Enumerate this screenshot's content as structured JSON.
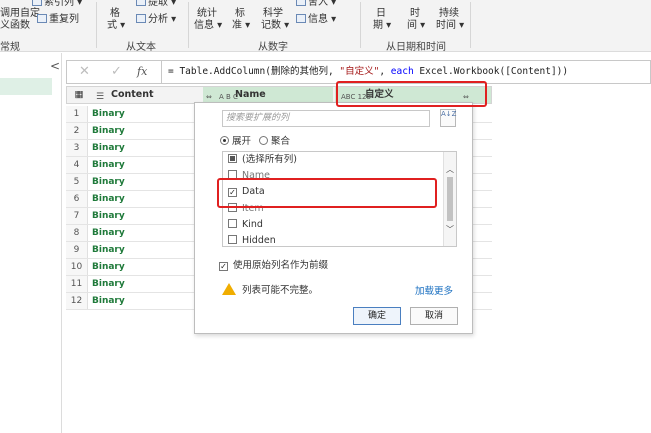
{
  "ribbon": {
    "top_row_fragments": [
      "索引列",
      "提取",
      "统计",
      "标",
      "科学",
      "舍入",
      "日",
      "时",
      "持续"
    ],
    "custom_func_line1": "调用自定",
    "custom_func_line2": "义函数",
    "duplicate_col": "重复列",
    "format_line1": "格",
    "format_line2": "式",
    "parse": "分析",
    "stats_info": "信息",
    "standard": "准",
    "sci_count": "记数",
    "info": "信息",
    "date_period": "期",
    "time_between": "间",
    "duration_time": "时间",
    "group_general": "常规",
    "group_from_text": "从文本",
    "group_from_number": "从数字",
    "group_from_datetime": "从日期和时间"
  },
  "formula_bar": {
    "cancel_glyph": "✕",
    "commit_glyph": "✓",
    "fx_label": "fx",
    "formula_parts": {
      "prefix": "= Table.AddColumn(删除的其他列, ",
      "string": "\"自定义\"",
      "mid": ", ",
      "keyword": "each",
      "suffix": " Excel.Workbook([Content]))"
    }
  },
  "table": {
    "columns": [
      {
        "label": "Content",
        "type_icon": "list-icon"
      },
      {
        "label": "Name",
        "type_icon": "abc-icon",
        "type_text": "A B C"
      },
      {
        "label": "自定义",
        "type_icon": "abc123-icon",
        "type_text": "ABC 123"
      }
    ],
    "rows": [
      {
        "index": "1",
        "content": "Binary"
      },
      {
        "index": "2",
        "content": "Binary"
      },
      {
        "index": "3",
        "content": "Binary"
      },
      {
        "index": "4",
        "content": "Binary"
      },
      {
        "index": "5",
        "content": "Binary"
      },
      {
        "index": "6",
        "content": "Binary"
      },
      {
        "index": "7",
        "content": "Binary"
      },
      {
        "index": "8",
        "content": "Binary"
      },
      {
        "index": "9",
        "content": "Binary"
      },
      {
        "index": "10",
        "content": "Binary"
      },
      {
        "index": "11",
        "content": "Binary"
      },
      {
        "index": "12",
        "content": "Binary"
      }
    ]
  },
  "expand_panel": {
    "search_placeholder": "搜索要扩展的列",
    "sort_label": "A↓Z",
    "radio_expand": "展开",
    "radio_aggregate": "聚合",
    "radio_selected": "expand",
    "list_items": [
      {
        "label": "(选择所有列)",
        "state": "partial"
      },
      {
        "label": "Name",
        "state": "unchecked"
      },
      {
        "label": "Data",
        "state": "checked"
      },
      {
        "label": "Item",
        "state": "unchecked"
      },
      {
        "label": "Kind",
        "state": "unchecked"
      },
      {
        "label": "Hidden",
        "state": "unchecked"
      }
    ],
    "use_original_prefix": "使用原始列名作为前缀",
    "use_original_checked": true,
    "warning_text": "列表可能不完整。",
    "load_more": "加载更多",
    "ok_label": "确定",
    "cancel_label": "取消"
  },
  "colors": {
    "highlight_red": "#e02020",
    "binary_green": "#1f7a3a",
    "selected_header": "#cfe8d4",
    "link_blue": "#1a6fc0",
    "warning_yellow": "#f0ad00"
  }
}
